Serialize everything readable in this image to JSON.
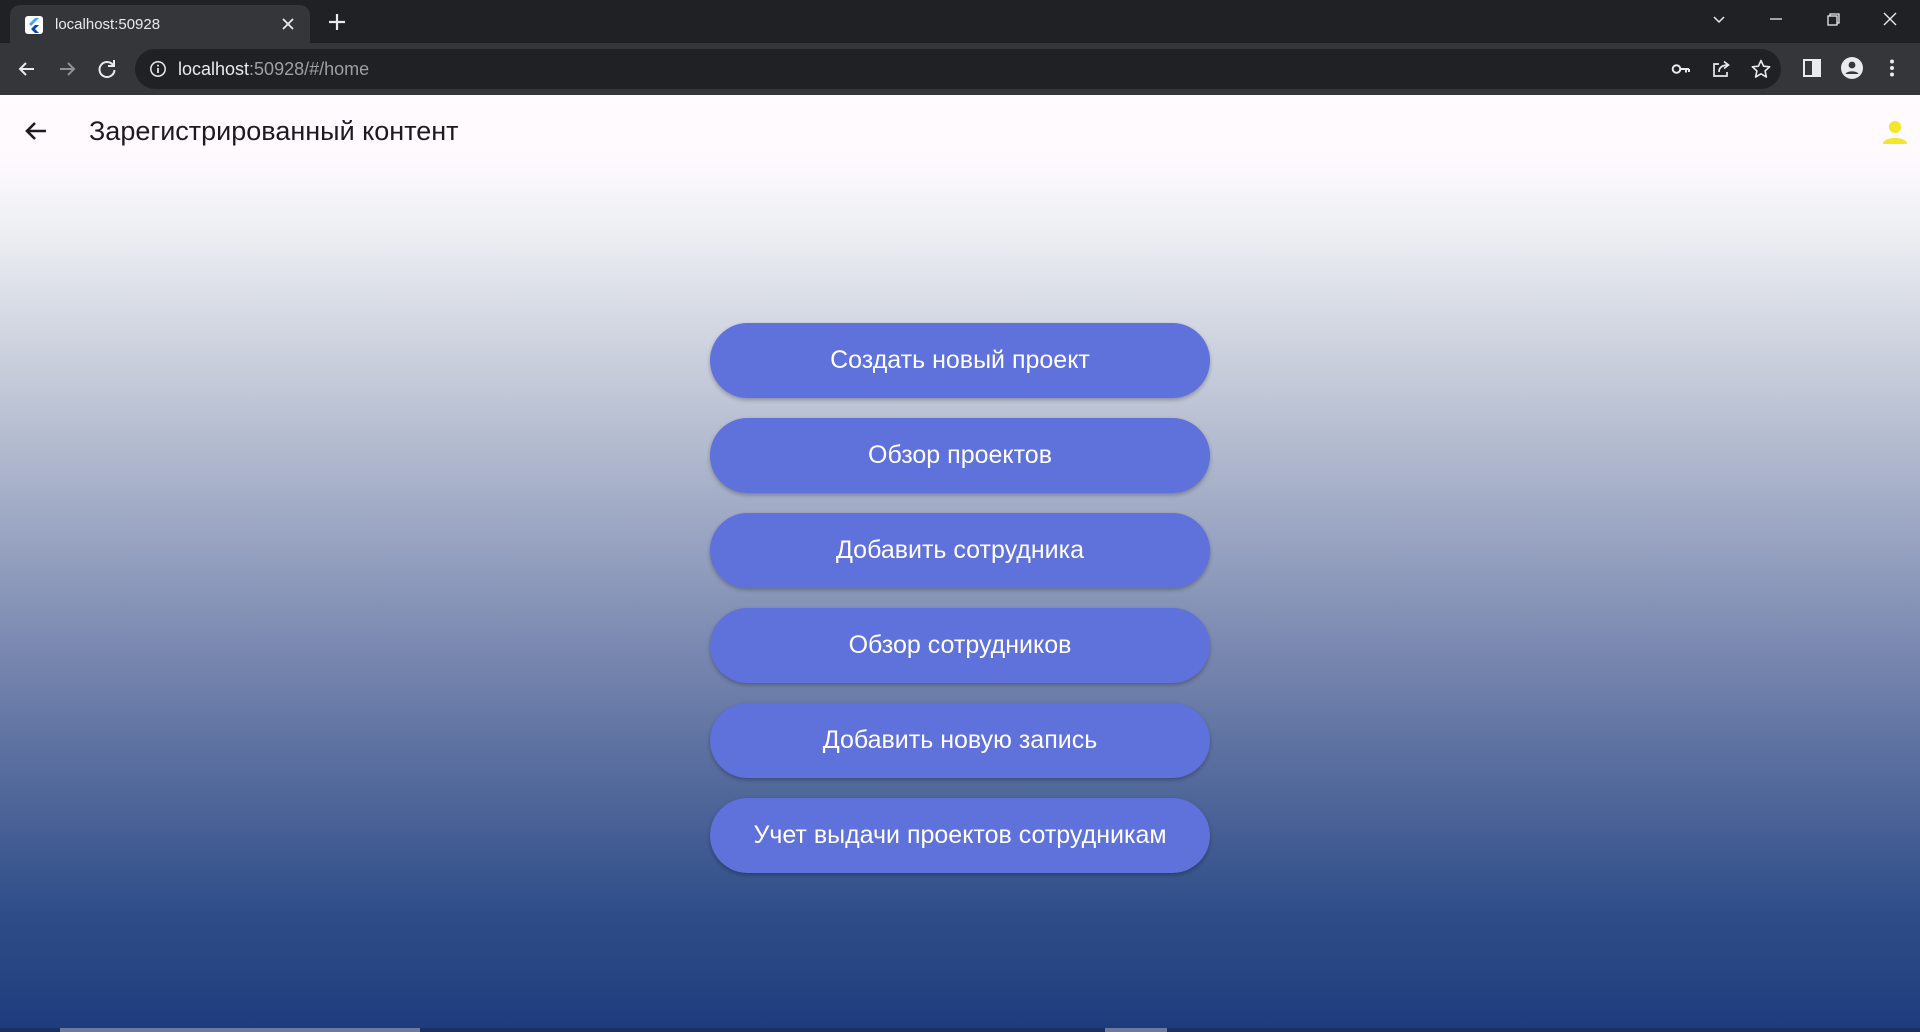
{
  "browser": {
    "tab": {
      "title": "localhost:50928",
      "favicon": "flutter-icon"
    },
    "address_bar": {
      "host": "localhost",
      "rest": ":50928/#/home"
    },
    "icons": {
      "back": "arrow-left-icon",
      "forward": "arrow-right-icon",
      "reload": "reload-icon",
      "site_info": "info-icon",
      "password": "key-icon",
      "share": "share-icon",
      "bookmark": "star-icon",
      "side_panel": "side-panel-icon",
      "profile": "person-icon",
      "menu": "more-vert-icon"
    }
  },
  "app": {
    "title": "Зарегистрированный контент",
    "back_icon": "arrow-left-icon",
    "account_icon": "person-icon",
    "account_icon_color": "#f5e62a",
    "button_color": "#5f71db",
    "menu": [
      {
        "label": "Создать новый проект"
      },
      {
        "label": "Обзор проектов"
      },
      {
        "label": "Добавить сотрудника"
      },
      {
        "label": "Обзор сотрудников"
      },
      {
        "label": "Добавить новую запись"
      },
      {
        "label": "Учет выдачи проектов сотрудникам"
      }
    ]
  }
}
